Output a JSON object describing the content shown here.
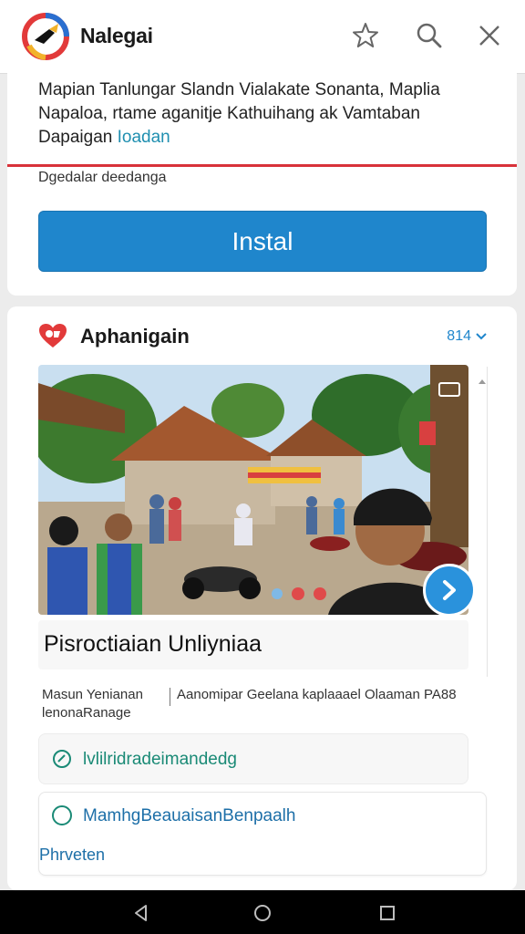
{
  "header": {
    "app_name": "Nalegai",
    "icons": [
      "app-logo",
      "star-icon",
      "search-icon",
      "close-icon"
    ]
  },
  "listing": {
    "description_line1": "Mapian Tanlungar Slandn Vialakate Sonanta, Maplia",
    "description_line2": "Napaloa, rtame aganitje Kathuihang ak Vamtaban",
    "description_line3_plain": "Dapaigan ",
    "description_line3_link": "Ioadan",
    "subnote": "Dgedalar deedanga",
    "install_label": "Instal"
  },
  "section": {
    "title": "Aphanigain",
    "version": "814",
    "photo_title": "Pisroctiaian Unliyniaa",
    "meta_left": "Masun Yenianan lenonaRanage",
    "meta_right": "Aanomipar Geelana kaplaaael Olaaman PA88",
    "option1_label": "lvlilridradeimandedg",
    "option2_label": "MamhgBeauaisanBenpaalh",
    "option2_sub": "Phrveten"
  },
  "colors": {
    "accent": "#1f86cc",
    "divider_red": "#d8323a",
    "option_green": "#1a8a76",
    "carousel_dots": [
      "#7fb9e6",
      "#e04a4a",
      "#e04a4a"
    ]
  }
}
